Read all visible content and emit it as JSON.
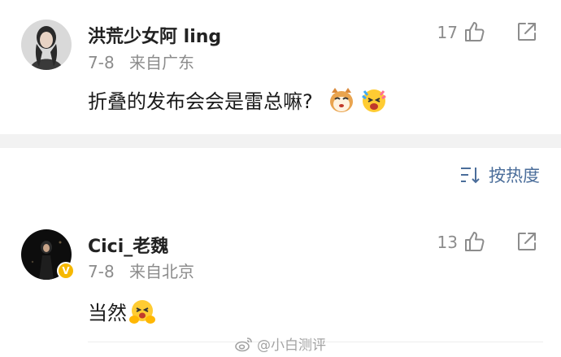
{
  "comments": [
    {
      "username": "洪荒少女阿 ling",
      "date": "7-8",
      "location": "来自广东",
      "text": "折叠的发布会会是雷总嘛?",
      "likes": "17",
      "emojis": [
        "cat-face-emoji",
        "excited-face-emoji"
      ],
      "verified": false
    },
    {
      "username": "Cici_老魏",
      "date": "7-8",
      "location": "来自北京",
      "text": "当然",
      "likes": "13",
      "emojis": [
        "grinning-hands-face-emoji"
      ],
      "verified": true,
      "verified_badge": "V"
    }
  ],
  "sort": {
    "label": "按热度"
  },
  "watermark": {
    "text": "@小白测评"
  },
  "colors": {
    "link": "#4a6d9a",
    "meta": "#8c8c8c",
    "band": "#f2f2f2",
    "badge": "#f6b800"
  }
}
